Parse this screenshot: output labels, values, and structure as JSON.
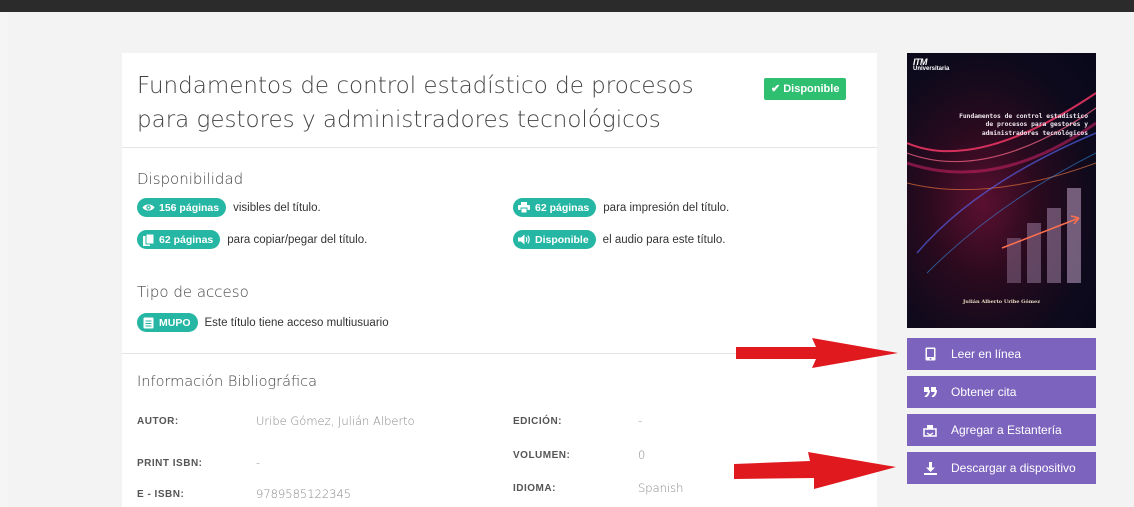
{
  "book": {
    "title": "Fundamentos de control estadístico de procesos para gestores y administradores tecnológicos",
    "status_badge": "Disponible"
  },
  "availability": {
    "heading": "Disponibilidad",
    "items": [
      {
        "pill": "156 páginas",
        "text": "visibles del título.",
        "icon": "eye-icon"
      },
      {
        "pill": "62 páginas",
        "text": "para impresión del título.",
        "icon": "printer-icon"
      },
      {
        "pill": "62 páginas",
        "text": "para copiar/pegar del título.",
        "icon": "copy-icon"
      },
      {
        "pill": "Disponible",
        "text": "el audio para este título.",
        "icon": "volume-icon"
      }
    ]
  },
  "access": {
    "heading": "Tipo de acceso",
    "pill": "MUPO",
    "text": "Este título tiene acceso multiusuario"
  },
  "bibliography": {
    "heading": "Información Bibliográfica",
    "author_label": "AUTOR:",
    "author_value": "Uribe Gómez, Julián Alberto",
    "print_isbn_label": "PRINT ISBN:",
    "print_isbn_value": "-",
    "eisbn_label": "E - ISBN:",
    "eisbn_value": "9789585122345",
    "edition_label": "EDICIÓN:",
    "edition_value": "-",
    "volume_label": "VOLUMEN:",
    "volume_value": "0",
    "language_label": "IDIOMA:",
    "language_value": "Spanish"
  },
  "cover": {
    "publisher_mark": "ITM",
    "publisher_sub": "Universitaria",
    "title": "Fundamentos de control estadístico de procesos para gestores y administradores tecnológicos",
    "author": "Julián Alberto Uribe Gómez"
  },
  "actions": [
    {
      "label": "Leer en línea",
      "icon": "tablet-icon"
    },
    {
      "label": "Obtener cita",
      "icon": "quote-icon"
    },
    {
      "label": "Agregar a Estantería",
      "icon": "shelf-icon"
    },
    {
      "label": "Descargar a dispositivo",
      "icon": "download-icon"
    }
  ],
  "colors": {
    "accent_purple": "#7c63bd",
    "pill_teal": "#26b6a4",
    "available_green": "#2fbf71",
    "annotation_red": "#e0191f"
  }
}
